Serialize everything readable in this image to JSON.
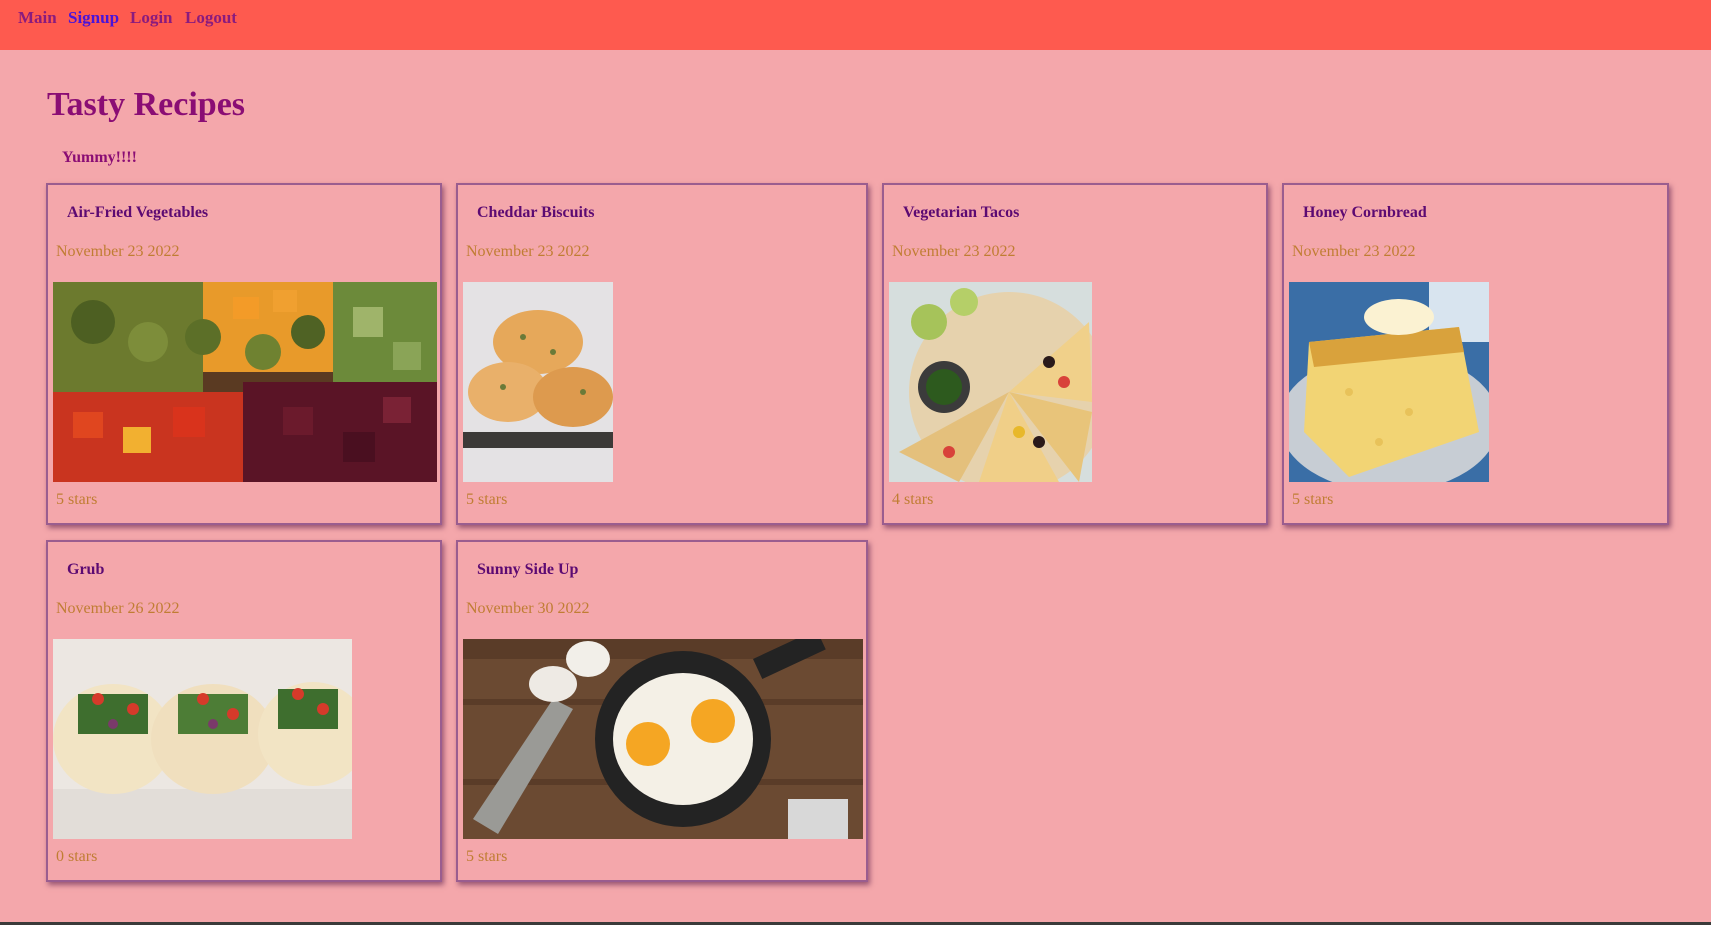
{
  "nav": {
    "items": [
      {
        "label": "Main"
      },
      {
        "label": "Signup"
      },
      {
        "label": "Login"
      },
      {
        "label": "Logout"
      }
    ]
  },
  "header": {
    "title": "Tasty Recipes",
    "tagline": "Yummy!!!!"
  },
  "recipes": [
    {
      "title": "Air-Fried Vegetables",
      "date": "November 23 2022",
      "rating": "5 stars",
      "image": "roasted-vegetables-photo"
    },
    {
      "title": "Cheddar Biscuits",
      "date": "November 23 2022",
      "rating": "5 stars",
      "image": "cheddar-biscuits-photo"
    },
    {
      "title": "Vegetarian Tacos",
      "date": "November 23 2022",
      "rating": "4 stars",
      "image": "vegetarian-tacos-photo"
    },
    {
      "title": "Honey Cornbread",
      "date": "November 23 2022",
      "rating": "5 stars",
      "image": "honey-cornbread-photo"
    },
    {
      "title": "Grub",
      "date": "November 26 2022",
      "rating": "0 stars",
      "image": "grub-tacos-photo"
    },
    {
      "title": "Sunny Side Up",
      "date": "November 30 2022",
      "rating": "5 stars",
      "image": "fried-eggs-photo"
    }
  ],
  "colors": {
    "background": "#f4a7ab",
    "navbar": "#fe5a4f",
    "title": "#8a0d74",
    "card_title": "#5c0a72",
    "meta_text": "#c07d33",
    "active_link": "#4a14d8"
  }
}
